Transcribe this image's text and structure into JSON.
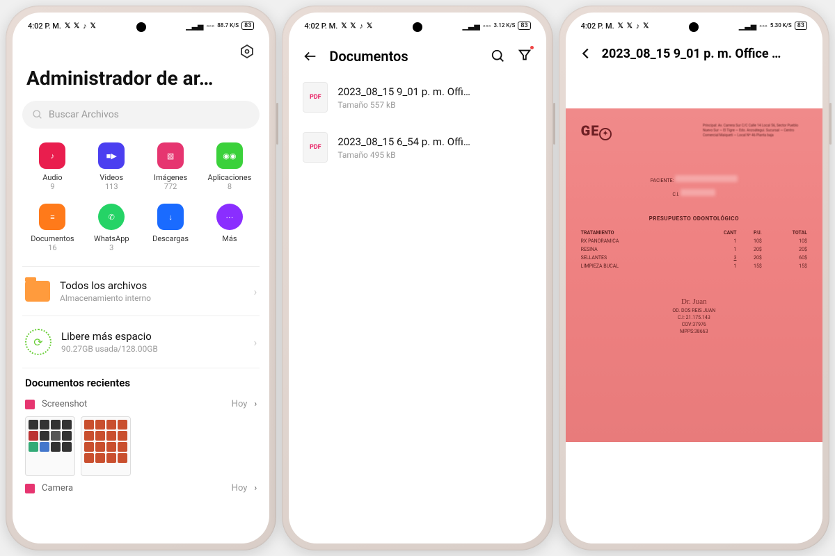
{
  "statusbar": {
    "time": "4:02 P. M.",
    "icons": [
      "X",
      "X",
      "♪",
      "X"
    ],
    "net1": "88.7 K/S",
    "net2": "3.12 K/S",
    "net3": "5.30 K/S",
    "battery": "83"
  },
  "screen1": {
    "title": "Administrador de ar…",
    "search_placeholder": "Buscar Archivos",
    "categories": [
      {
        "label": "Audio",
        "count": "9",
        "icon": "audio",
        "color": "#e91e4e"
      },
      {
        "label": "Videos",
        "count": "113",
        "icon": "video",
        "color": "#4b3ff0"
      },
      {
        "label": "Imágenes",
        "count": "772",
        "icon": "image",
        "color": "#e63570"
      },
      {
        "label": "Aplicaciones",
        "count": "8",
        "icon": "android",
        "color": "#3bd13b"
      },
      {
        "label": "Documentos",
        "count": "16",
        "icon": "doc",
        "color": "#ff7a1a"
      },
      {
        "label": "WhatsApp",
        "count": "3",
        "icon": "whatsapp",
        "color": "#25d366"
      },
      {
        "label": "Descargas",
        "count": "",
        "icon": "download",
        "color": "#1a6bff"
      },
      {
        "label": "Más",
        "count": "",
        "icon": "more",
        "color": "#8a2eff"
      }
    ],
    "all_files": {
      "title": "Todos los archivos",
      "sub": "Almacenamiento interno"
    },
    "free_space": {
      "title": "Libere más espacio",
      "sub": "90.27GB usada/128.00GB"
    },
    "recent_header": "Documentos recientes",
    "recent_rows": [
      {
        "label": "Screenshot",
        "tag": "Hoy"
      },
      {
        "label": "Camera",
        "tag": "Hoy"
      }
    ]
  },
  "screen2": {
    "title": "Documentos",
    "items": [
      {
        "title": "2023_08_15 9_01 p. m. Offi…",
        "sub": "Tamaño 557 kB"
      },
      {
        "title": "2023_08_15 6_54 p. m. Offi…",
        "sub": "Tamaño 495 kB"
      }
    ]
  },
  "screen3": {
    "title": "2023_08_15 9_01 p. m. Office …",
    "doc": {
      "logo": "GE",
      "patient_label": "PACIENTE:",
      "ci_label": "C.I.",
      "budget_title": "PRESUPUESTO ODONTOLÓGICO",
      "headers": [
        "TRATAMIENTO",
        "CANT",
        "P.U.",
        "TOTAL"
      ],
      "rows": [
        [
          "RX PANORAMICA",
          "1",
          "10$",
          "10$"
        ],
        [
          "RESINA",
          "1",
          "20$",
          "20$"
        ],
        [
          "SELLANTES",
          "3",
          "20$",
          "60$"
        ],
        [
          "LIMPIEZA BUCAL",
          "1",
          "15$",
          "15$"
        ]
      ],
      "signature": [
        "OD. DOS REIS JUAN",
        "C.I: 21.175.143",
        "COV:37976",
        "MPPS:38663"
      ]
    }
  }
}
